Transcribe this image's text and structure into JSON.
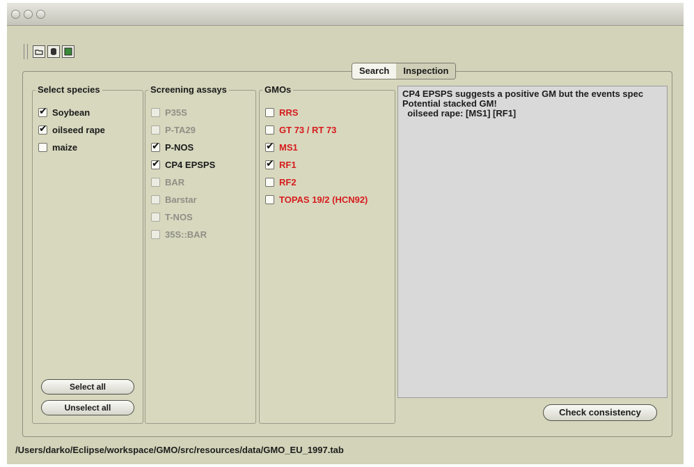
{
  "window": {
    "title": ""
  },
  "toolbar": {
    "icons": [
      "open-icon",
      "database-icon",
      "image-icon"
    ]
  },
  "tabs": [
    {
      "label": "Search",
      "active": true
    },
    {
      "label": "Inspection",
      "active": false
    }
  ],
  "species": {
    "title": "Select species",
    "items": [
      {
        "label": "Soybean",
        "checked": true
      },
      {
        "label": "oilseed rape",
        "checked": true
      },
      {
        "label": "maize",
        "checked": false
      }
    ],
    "select_all": "Select all",
    "unselect_all": "Unselect all"
  },
  "assays": {
    "title": "Screening assays",
    "items": [
      {
        "label": "P35S",
        "checked": false,
        "enabled": false
      },
      {
        "label": "P-TA29",
        "checked": false,
        "enabled": false
      },
      {
        "label": "P-NOS",
        "checked": true,
        "enabled": true
      },
      {
        "label": "CP4 EPSPS",
        "checked": true,
        "enabled": true
      },
      {
        "label": "BAR",
        "checked": false,
        "enabled": false
      },
      {
        "label": "Barstar",
        "checked": false,
        "enabled": false
      },
      {
        "label": "T-NOS",
        "checked": false,
        "enabled": false
      },
      {
        "label": "35S::BAR",
        "checked": false,
        "enabled": false
      }
    ]
  },
  "gmos": {
    "title": "GMOs",
    "items": [
      {
        "label": "RRS",
        "checked": false
      },
      {
        "label": "GT 73 / RT 73",
        "checked": false
      },
      {
        "label": "MS1",
        "checked": true
      },
      {
        "label": "RF1",
        "checked": true
      },
      {
        "label": "RF2",
        "checked": false
      },
      {
        "label": "TOPAS 19/2 (HCN92)",
        "checked": false
      }
    ]
  },
  "output": {
    "text": "CP4 EPSPS suggests a positive GM but the events spec\nPotential stacked GM!\n  oilseed rape: [MS1] [RF1]"
  },
  "check_button": "Check consistency",
  "status": {
    "path": "/Users/darko/Eclipse/workspace/GMO/src/resources/data/GMO_EU_1997.tab"
  },
  "colors": {
    "window_bg": "#d3d3b9",
    "gmo_label": "#d61c1c",
    "disabled_label": "#8f8f86"
  }
}
